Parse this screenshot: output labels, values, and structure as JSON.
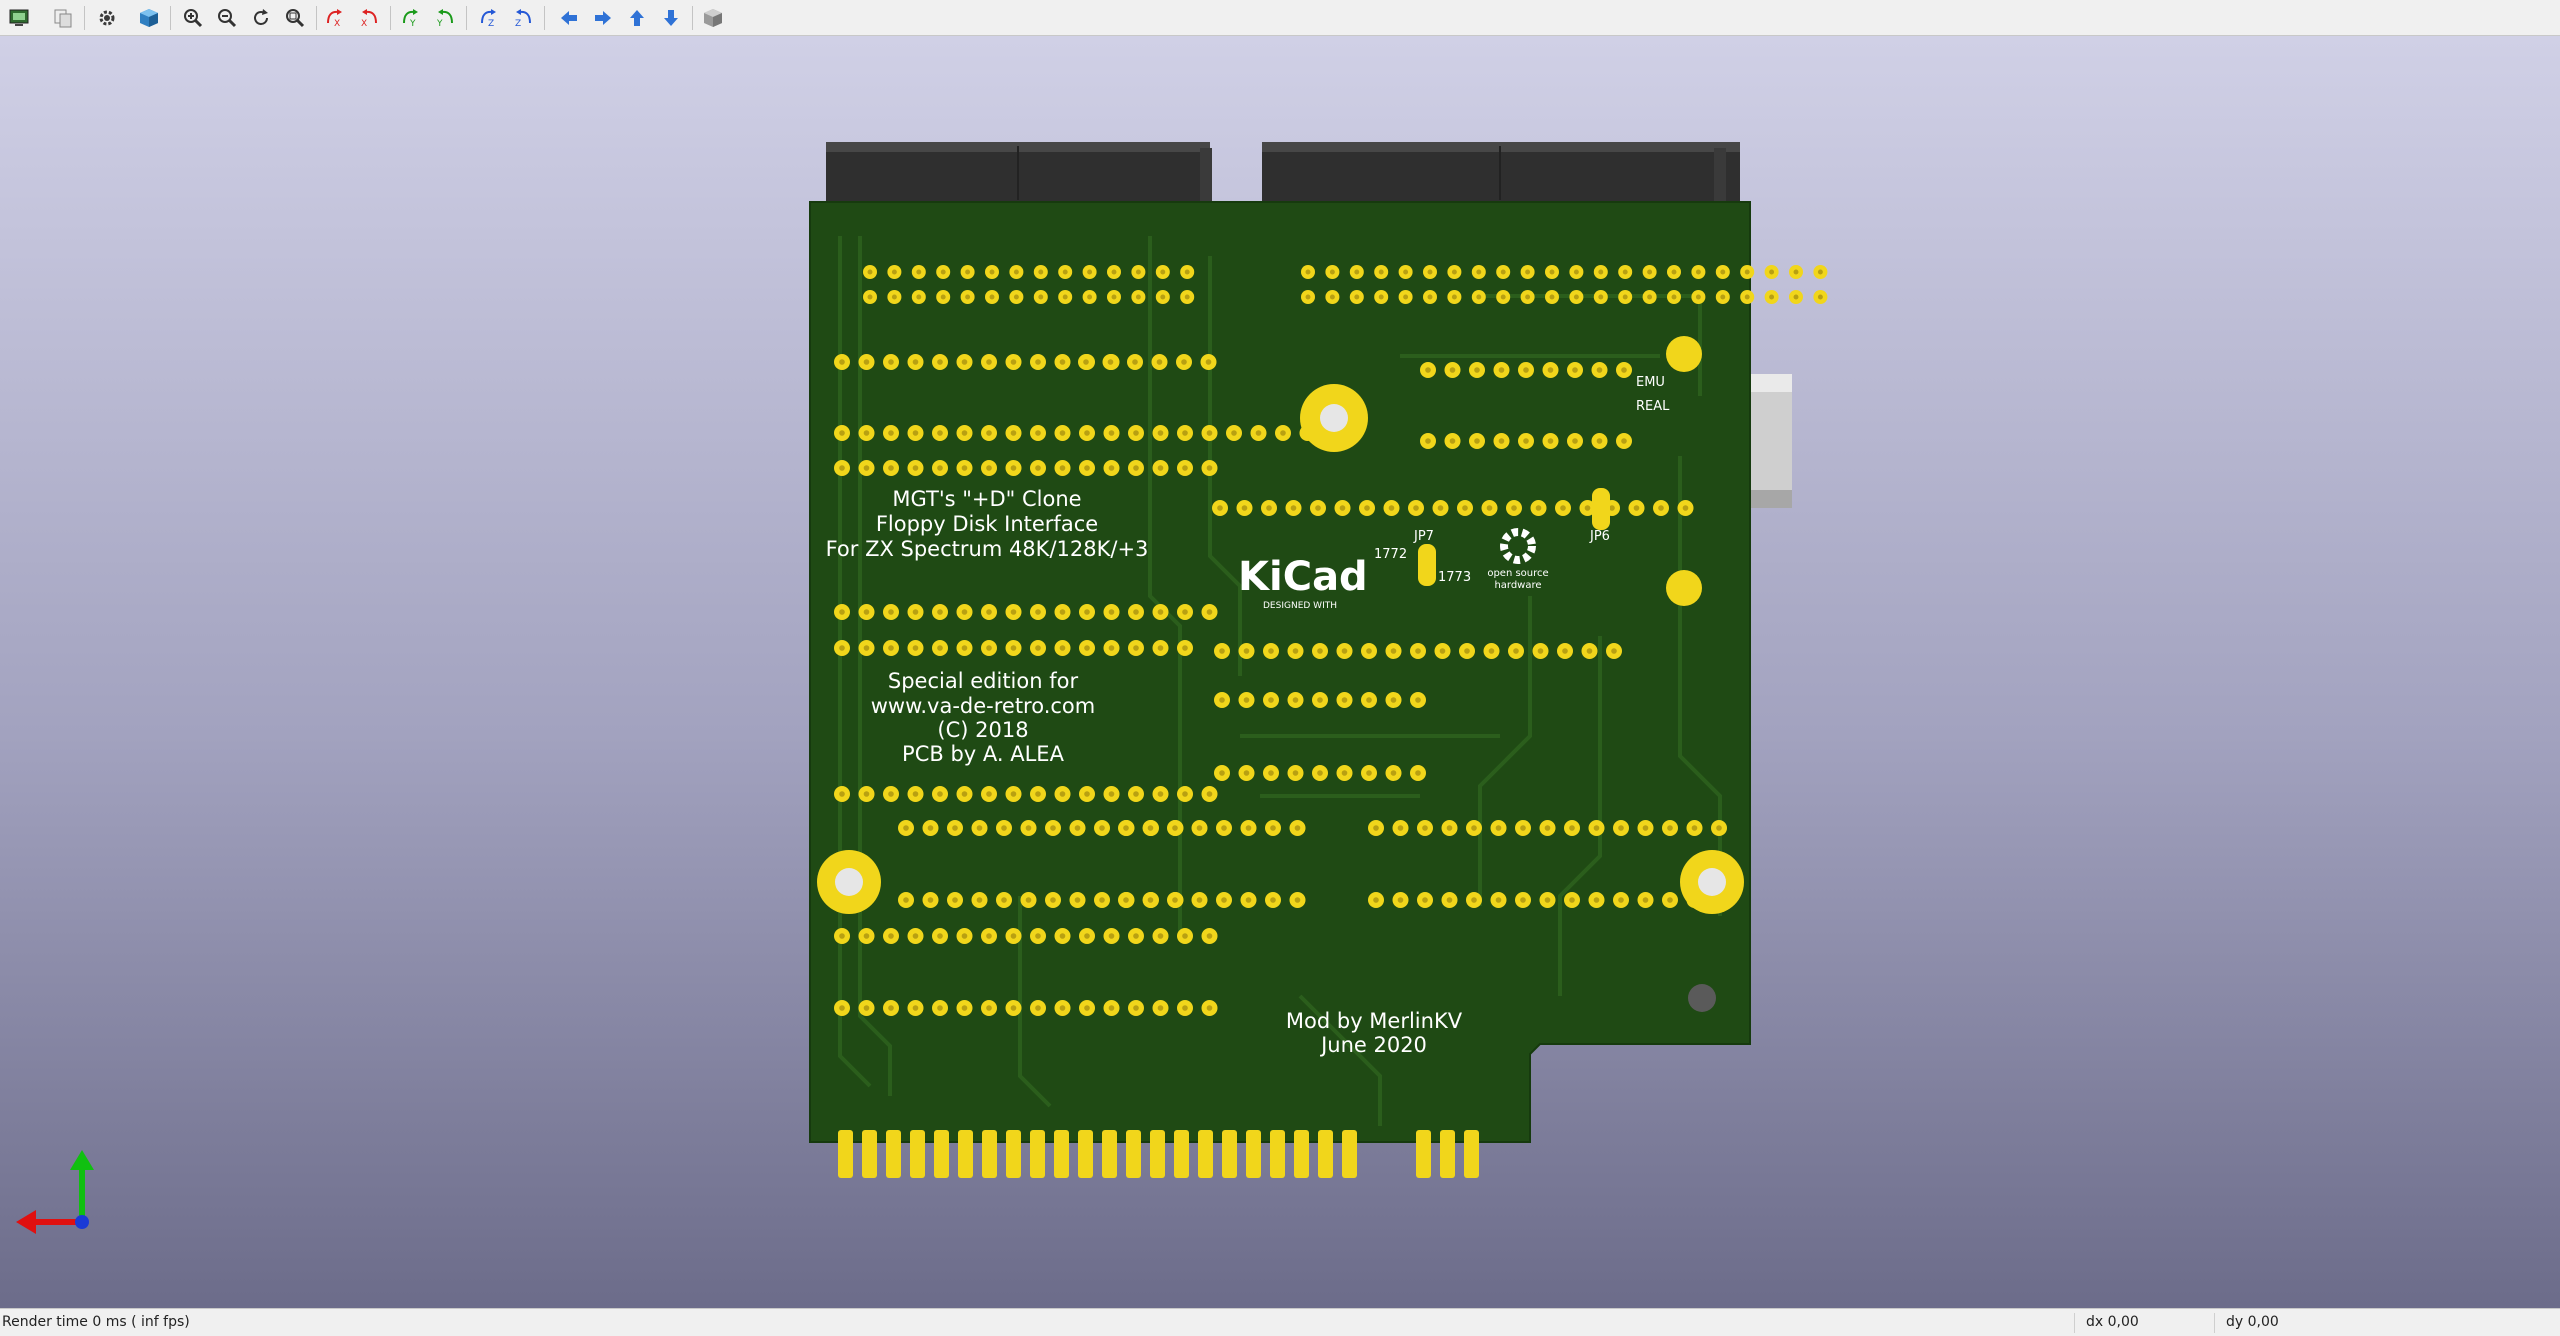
{
  "toolbar": {
    "buttons": [
      {
        "name": "render-realtime-icon",
        "tooltip": ""
      },
      {
        "name": "copy-image-icon",
        "tooltip": ""
      },
      {
        "name": "settings-gear-icon",
        "tooltip": ""
      },
      {
        "name": "raytracing-cube-icon",
        "tooltip": ""
      },
      {
        "name": "zoom-in-icon",
        "tooltip": ""
      },
      {
        "name": "zoom-out-icon",
        "tooltip": ""
      },
      {
        "name": "redraw-icon",
        "tooltip": ""
      },
      {
        "name": "zoom-fit-icon",
        "tooltip": ""
      },
      {
        "name": "rotate-x-cw-icon",
        "tooltip": ""
      },
      {
        "name": "rotate-x-ccw-icon",
        "tooltip": ""
      },
      {
        "name": "rotate-y-cw-icon",
        "tooltip": ""
      },
      {
        "name": "rotate-y-ccw-icon",
        "tooltip": ""
      },
      {
        "name": "rotate-z-cw-icon",
        "tooltip": ""
      },
      {
        "name": "rotate-z-ccw-icon",
        "tooltip": ""
      },
      {
        "name": "pan-left-icon",
        "tooltip": ""
      },
      {
        "name": "pan-right-icon",
        "tooltip": ""
      },
      {
        "name": "pan-up-icon",
        "tooltip": ""
      },
      {
        "name": "pan-down-icon",
        "tooltip": ""
      },
      {
        "name": "ortho-cube-icon",
        "tooltip": ""
      }
    ]
  },
  "pcb": {
    "title_lines": [
      "MGT's \"+D\" Clone",
      "Floppy Disk Interface",
      "For ZX Spectrum 48K/128K/+3"
    ],
    "edition_lines": [
      "Special edition for",
      "www.va-de-retro.com",
      "(C) 2018",
      "PCB by A. ALEA"
    ],
    "mod_lines": [
      "Mod by MerlinKV",
      "June 2020"
    ],
    "logo": {
      "text": "KiCad",
      "subtext": "DESIGNED WITH"
    },
    "oshw": {
      "line1": "open source",
      "line2": "hardware"
    },
    "labels": {
      "jp7": "JP7",
      "j1772": "1772",
      "j1773": "1773",
      "jp6": "JP6",
      "emu": "EMU",
      "real": "REAL"
    },
    "colors": {
      "board": "#1f4a14",
      "copper_trace": "#2b5e1c",
      "pad_gold": "#f1d61b",
      "silk": "#ffffff"
    }
  },
  "status": {
    "render_time": "Render time 0 ms ( inf fps)",
    "dx": "dx 0,00",
    "dy": "dy 0,00"
  }
}
